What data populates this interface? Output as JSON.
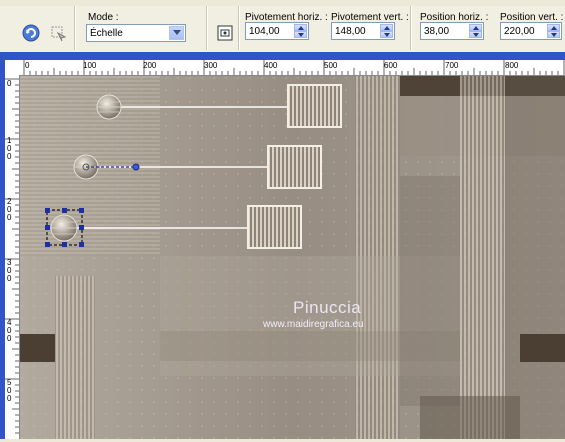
{
  "toolbar": {
    "mode_label": "Mode :",
    "mode_value": "Échelle",
    "pivot_h_label": "Pivotement horiz. :",
    "pivot_h_value": "104,00",
    "pivot_v_label": "Pivotement vert. :",
    "pivot_v_value": "148,00",
    "pos_h_label": "Position horiz. :",
    "pos_h_value": "38,00",
    "pos_v_label": "Position vert. :",
    "pos_v_value": "220,00"
  },
  "ruler": {
    "h_ticks": [
      "0",
      "100",
      "200",
      "300",
      "400",
      "500",
      "600",
      "700",
      "800"
    ],
    "v_ticks": [
      "0",
      "100",
      "200",
      "300",
      "400",
      "500"
    ]
  },
  "watermark": {
    "title": "Pinuccia",
    "url": "www.maidiregrafica.eu"
  },
  "colors": {
    "workspace_border": "#2f55c9",
    "toolbar_bg": "#f1efe2",
    "canvas_base": "#a39a8f"
  }
}
